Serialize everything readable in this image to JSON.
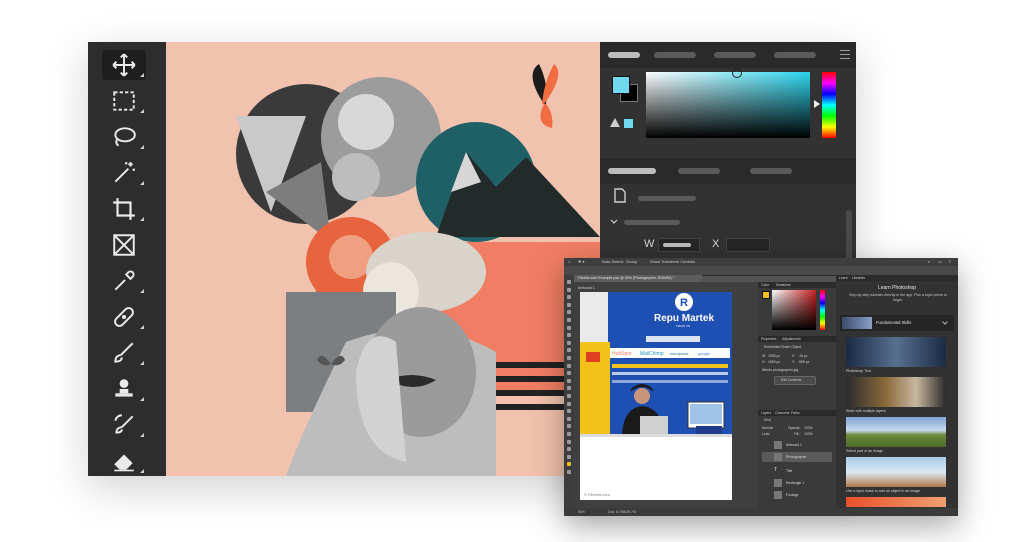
{
  "small_window": {
    "menubar": {
      "items": [
        "Auto-Select:",
        "Group",
        "Show Transform Controls"
      ]
    },
    "document_tab": "Fileinfo.com Example.psd @ 50% (Photographer, RGB/8#) *",
    "artboard_label": "Artboard 1",
    "photo": {
      "brand_name": "Repu Martek",
      "logo_letter": "R",
      "brand_sub": "TRAIN VN",
      "partners": [
        "HubSpot",
        "MailChimp",
        "wordpress",
        "google"
      ],
      "watermark": "© FileInfo.com"
    },
    "status_bar": {
      "zoom": "50%",
      "doc_size": "Doc: 6.75M/29.7M"
    },
    "color_panel": {
      "tabs": [
        "Color",
        "Swatches"
      ],
      "fg_color": "#f3c01a",
      "selected_color": "#c42020"
    },
    "properties_panel": {
      "tabs": [
        "Properties",
        "Adjustments"
      ],
      "object_type": "Embedded Smart Object",
      "w_label": "W:",
      "w_value": "1598 px",
      "x_label": "X:",
      "x_value": "-18 px",
      "h_label": "H:",
      "h_value": "1659 px",
      "y_label": "Y:",
      "y_value": "-565 px",
      "file_name": "fileinfo-photographer.jpg",
      "edit_button": "Edit Contents"
    },
    "layers_panel": {
      "tabs": [
        "Layers",
        "Channels",
        "Paths"
      ],
      "search_label": "Kind",
      "blend_mode": "Normal",
      "opacity_label": "Opacity:",
      "opacity_value": "100%",
      "lock_label": "Lock:",
      "fill_label": "Fill:",
      "fill_value": "100%",
      "items": [
        "Artboard 1",
        "Photographer",
        "Title",
        "Rectangle 1",
        "Footage"
      ]
    },
    "learn_panel": {
      "tabs": [
        "Learn",
        "Libraries"
      ],
      "title": "Learn Photoshop",
      "subtitle": "Step-by-step tutorials directly in the app. Pick a topic below to begin.",
      "section": "Fundamental Skills",
      "cards": [
        "Photoshop Tour",
        "Work with multiple layers",
        "Select part of an image",
        "Use a layer mask to add an object to an image"
      ]
    }
  },
  "big_window": {
    "tools": [
      "move-tool",
      "marquee-tool",
      "lasso-tool",
      "magic-wand-tool",
      "crop-tool",
      "frame-tool",
      "eyedropper-tool",
      "healing-tool",
      "brush-tool",
      "stamp-tool",
      "history-brush-tool",
      "eraser-tool"
    ],
    "width_label": "W",
    "x_label": "X",
    "fg_color": "#6fd9f0",
    "canvas_bg": "#f1c2ad"
  }
}
